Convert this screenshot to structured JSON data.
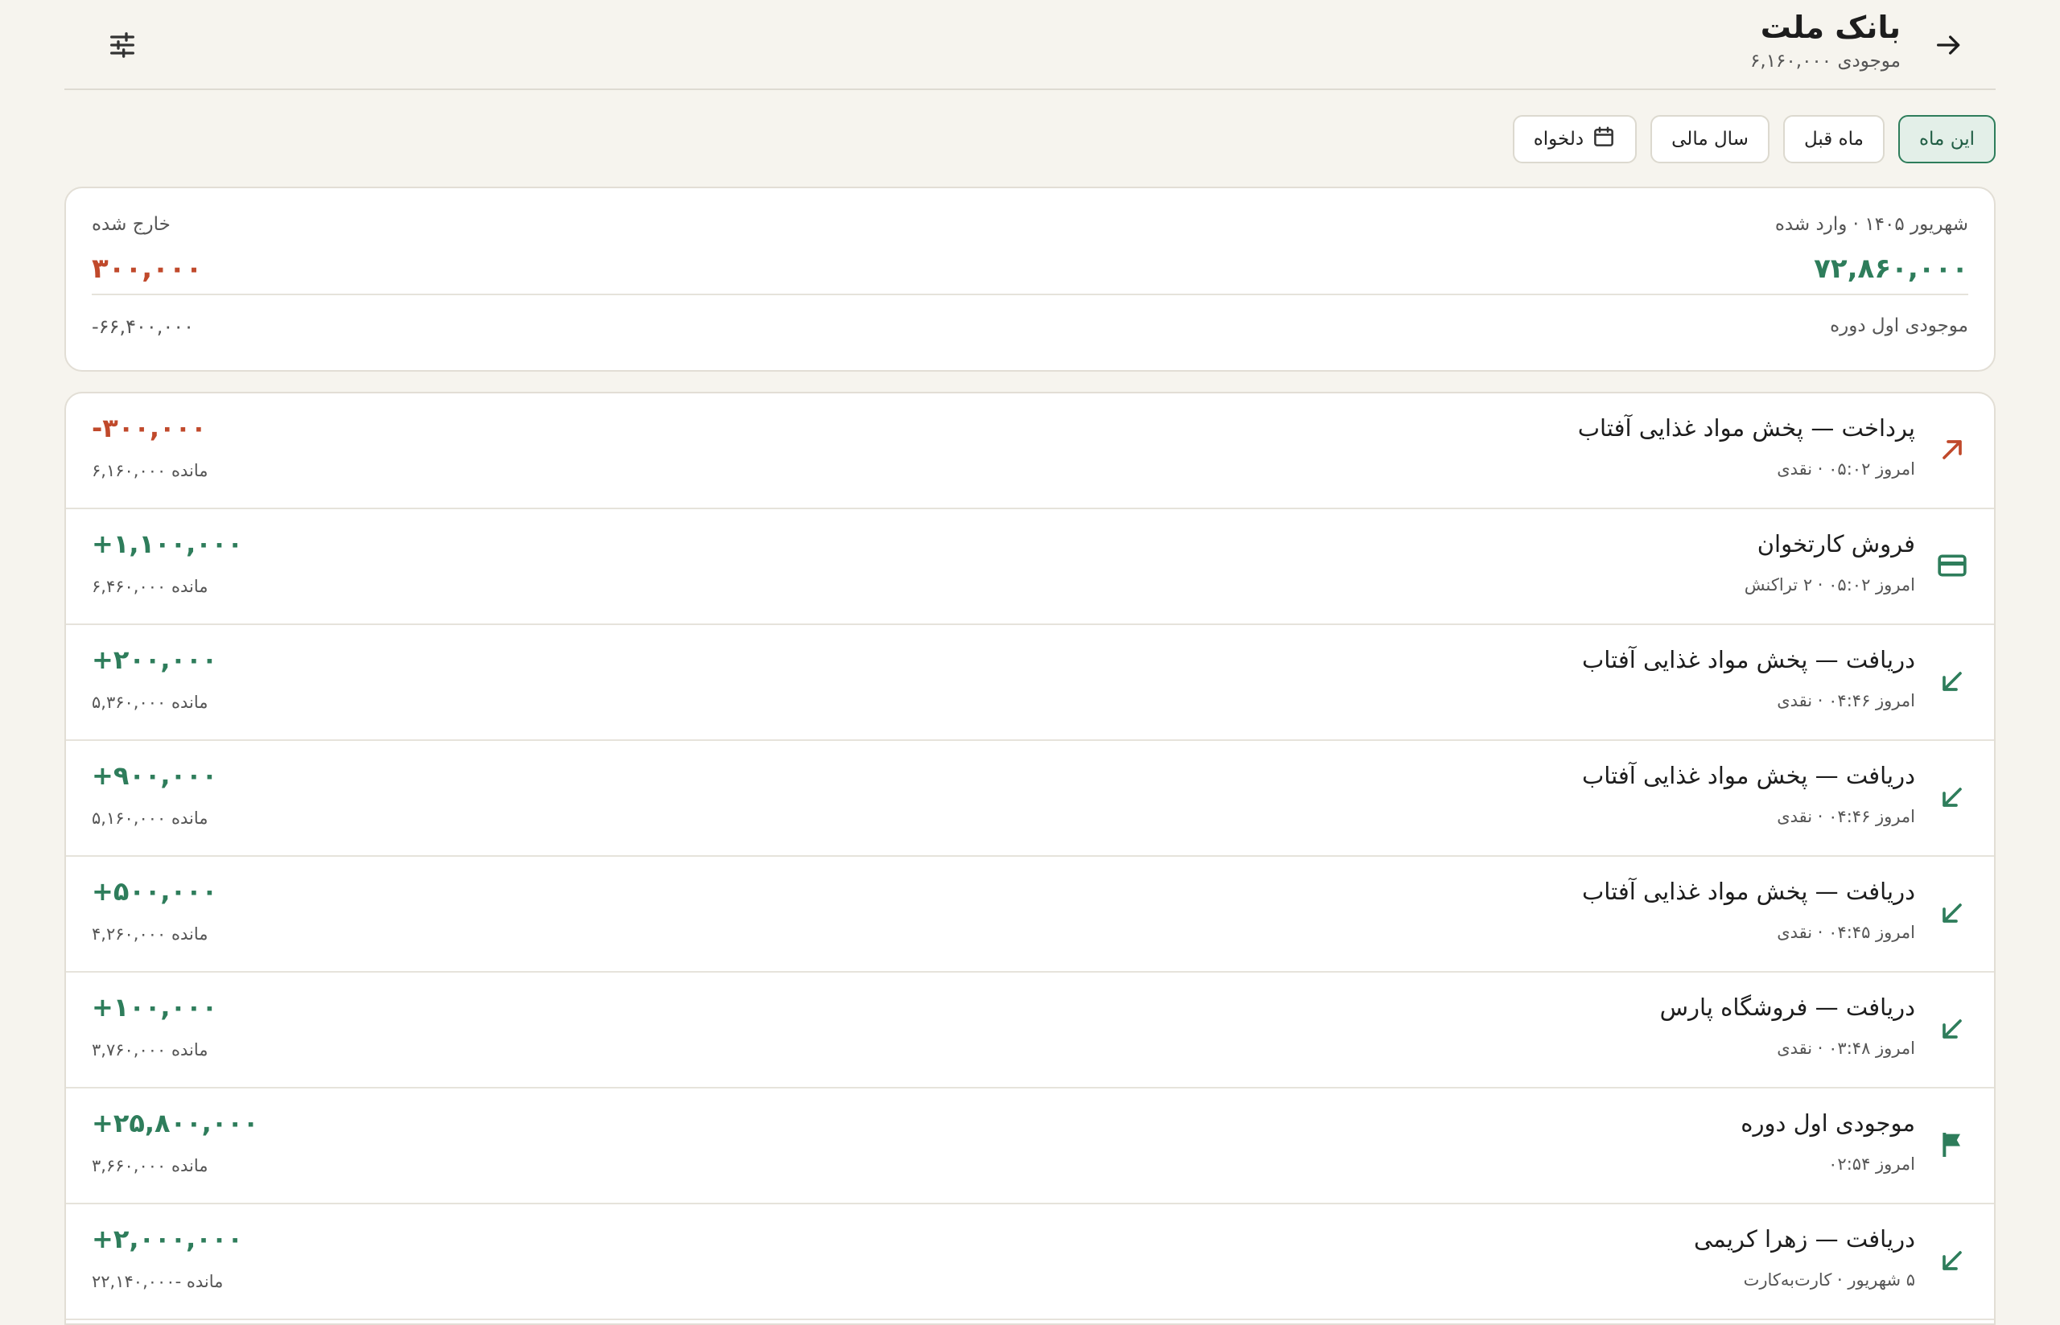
{
  "header": {
    "title": "بانک ملت",
    "subtitle": "موجودی ۶,۱۶۰,۰۰۰",
    "back_icon": "arrow-right-icon",
    "filter_icon": "tune-sliders-icon"
  },
  "tabs": [
    {
      "label": "این ماه",
      "active": true
    },
    {
      "label": "ماه قبل",
      "active": false
    },
    {
      "label": "سال مالی",
      "active": false
    },
    {
      "label": "دلخواه",
      "active": false,
      "icon": "calendar-icon"
    }
  ],
  "summary": {
    "period_in_label": "شهریور ۱۴۰۵ · وارد شده",
    "in_value": "۷۲,۸۶۰,۰۰۰",
    "out_label": "خارج شده",
    "out_value": "۳۰۰,۰۰۰",
    "opening_label": "موجودی اول دوره",
    "opening_value": "-۶۶,۴۰۰,۰۰۰"
  },
  "transactions": [
    {
      "title": "پرداخت — پخش مواد غذایی آفتاب",
      "meta": "امروز ۰۵:۰۲ · نقدی",
      "amount": "-۳۰۰,۰۰۰",
      "balance": "مانده ۶,۱۶۰,۰۰۰",
      "icon": "arrow-up-right-icon"
    },
    {
      "title": "فروش کارتخوان",
      "meta": "امروز ۰۵:۰۲ · ۲ تراکنش",
      "amount": "+۱,۱۰۰,۰۰۰",
      "balance": "مانده ۶,۴۶۰,۰۰۰",
      "icon": "credit-card-icon"
    },
    {
      "title": "دریافت — پخش مواد غذایی آفتاب",
      "meta": "امروز ۰۴:۴۶ · نقدی",
      "amount": "+۲۰۰,۰۰۰",
      "balance": "مانده ۵,۳۶۰,۰۰۰",
      "icon": "arrow-down-left-icon"
    },
    {
      "title": "دریافت — پخش مواد غذایی آفتاب",
      "meta": "امروز ۰۴:۴۶ · نقدی",
      "amount": "+۹۰۰,۰۰۰",
      "balance": "مانده ۵,۱۶۰,۰۰۰",
      "icon": "arrow-down-left-icon"
    },
    {
      "title": "دریافت — پخش مواد غذایی آفتاب",
      "meta": "امروز ۰۴:۴۵ · نقدی",
      "amount": "+۵۰۰,۰۰۰",
      "balance": "مانده ۴,۲۶۰,۰۰۰",
      "icon": "arrow-down-left-icon"
    },
    {
      "title": "دریافت — فروشگاه پارس",
      "meta": "امروز ۰۳:۴۸ · نقدی",
      "amount": "+۱۰۰,۰۰۰",
      "balance": "مانده ۳,۷۶۰,۰۰۰",
      "icon": "arrow-down-left-icon"
    },
    {
      "title": "موجودی اول دوره",
      "meta": "امروز ۰۲:۵۴",
      "amount": "+۲۵,۸۰۰,۰۰۰",
      "balance": "مانده ۳,۶۶۰,۰۰۰",
      "icon": "flag-icon"
    },
    {
      "title": "دریافت — زهرا کریمی",
      "meta": "۵ شهریور · کارت‌به‌کارت",
      "amount": "+۲,۰۰۰,۰۰۰",
      "balance": "مانده -۲۲,۱۴۰,۰۰۰",
      "icon": "arrow-down-left-icon"
    }
  ],
  "colors": {
    "accent_green": "#2e7d5b",
    "negative_red": "#c0492b",
    "background": "#f6f4ee"
  }
}
